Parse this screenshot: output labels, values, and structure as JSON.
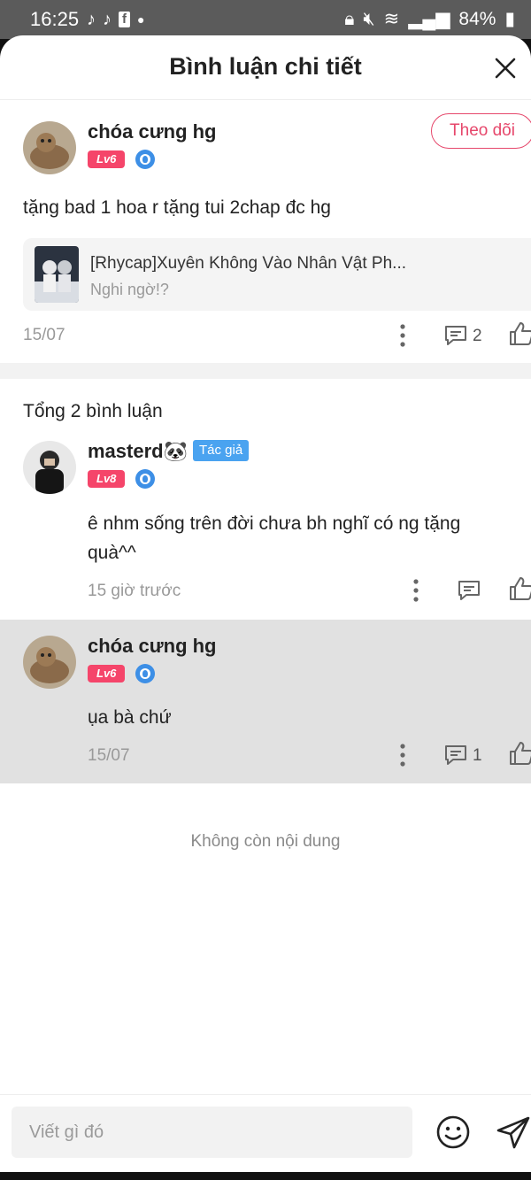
{
  "status_bar": {
    "time": "16:25",
    "battery": "84%",
    "left_icons": [
      "tiktok-icon",
      "tiktok-icon",
      "facebook-icon",
      "dot-icon"
    ]
  },
  "header": {
    "title": "Bình luận chi tiết"
  },
  "post": {
    "username": "chóa cưng hg",
    "level": "Lv6",
    "follow_label": "Theo dõi",
    "text": "tặng bad 1 hoa r tặng tui 2chap đc hg",
    "link": {
      "title": "[Rhycap]Xuyên Không Vào Nhân Vật Ph...",
      "subtitle": "Nghi ngờ!?"
    },
    "date": "15/07",
    "reply_count": "2"
  },
  "comments": {
    "total_label": "Tổng 2 bình luận",
    "items": [
      {
        "username": "masterd🐼",
        "author_tag": "Tác giả",
        "level": "Lv8",
        "text": "ê nhm sống trên đời chưa bh nghĩ có ng tặng quà^^",
        "time": "15 giờ trước",
        "reply_count": ""
      },
      {
        "username": "chóa cưng hg",
        "level": "Lv6",
        "text": "ụa bà chứ",
        "time": "15/07",
        "reply_count": "1"
      }
    ]
  },
  "end_text": "Không còn nội dung",
  "composer": {
    "placeholder": "Viết gì đó"
  },
  "colors": {
    "accent": "#e6476b",
    "level_badge": "#f5456a",
    "author_tag": "#4aa3f0",
    "vip_badge": "#3d8fe6",
    "highlight": "#e1e1e1"
  }
}
